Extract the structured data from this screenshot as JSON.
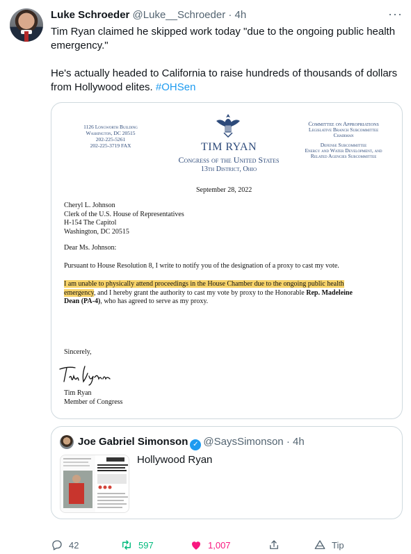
{
  "tweet": {
    "author_name": "Luke Schroeder",
    "author_handle": "@Luke__Schroeder",
    "separator": "·",
    "time": "4h",
    "more_icon": "more-horizontal-icon",
    "text_line1": "Tim Ryan claimed he skipped work today \"due to the ongoing public health emergency.\"",
    "text_line2_prefix": "He's actually headed to California to raise hundreds of thousands of dollars from Hollywood elites. ",
    "hashtag": "#OHSen"
  },
  "letter": {
    "address_left": [
      "1126 Longworth Building",
      "Washington, DC 20515",
      "202-225-5261",
      "202-225-3719 FAX"
    ],
    "committee_right": {
      "title": "Committee on Appropriations",
      "sub1": "Legislative Branch Subcommittee",
      "sub1b": "Chairman",
      "sub2": "Defense Subcommittee",
      "sub3": "Energy and Water Development, and",
      "sub4": "Related Agencies Subcommittee"
    },
    "name": "TIM RYAN",
    "congress": "Congress of the United States",
    "district": "13th District, Ohio",
    "date": "September 28, 2022",
    "recipient": [
      "Cheryl L. Johnson",
      "Clerk of the U.S. House of Representatives",
      "H-154 The Capitol",
      "Washington, DC  20515"
    ],
    "salutation": "Dear Ms. Johnson:",
    "para1": "Pursuant to House Resolution 8, I write to notify you of the designation of a proxy to cast my vote.",
    "para2_highlight_a": "I am unable to physically attend proceedings in the House Chamber due to the ongoing public health",
    "para2_highlight_b": "emergency",
    "para2_rest_a": ", and I hereby grant the authority to cast my vote by proxy to the Honorable ",
    "para2_bold": "Rep. Madeleine",
    "para2_bold2": "Dean (PA-4)",
    "para2_rest_b": ", who has agreed to serve as my proxy.",
    "closing": "Sincerely,",
    "signature_text": "Tim Ryan",
    "signer_name": "Tim Ryan",
    "signer_title": "Member of Congress"
  },
  "quote": {
    "author_name": "Joe Gabriel Simonson",
    "verified_icon": "verified-badge-icon",
    "author_handle": "@SaysSimonson",
    "separator": "·",
    "time": "4h",
    "text": "Hollywood Ryan"
  },
  "actions": {
    "reply_count": "42",
    "retweet_count": "597",
    "like_count": "1,007",
    "tip_label": "Tip",
    "colors": {
      "retweet": "#00ba7c",
      "like": "#f91880",
      "default": "#536471",
      "link": "#1d9bf0",
      "highlight": "#f7d36a"
    }
  }
}
